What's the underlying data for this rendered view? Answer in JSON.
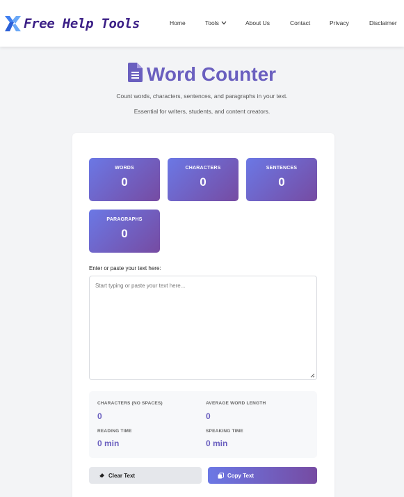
{
  "header": {
    "logo_text": "Free Help Tools",
    "nav": [
      {
        "label": "Home"
      },
      {
        "label": "Tools",
        "has_dropdown": true
      },
      {
        "label": "About Us"
      },
      {
        "label": "Contact"
      },
      {
        "label": "Privacy"
      },
      {
        "label": "Disclaimer"
      }
    ]
  },
  "hero": {
    "title": "Word Counter",
    "icon": "document-icon",
    "subtitle_1": "Count words, characters, sentences, and paragraphs in your text.",
    "subtitle_2": "Essential for writers, students, and content creators."
  },
  "stats": [
    {
      "label": "WORDS",
      "value": "0"
    },
    {
      "label": "CHARACTERS",
      "value": "0"
    },
    {
      "label": "SENTENCES",
      "value": "0"
    },
    {
      "label": "PARAGRAPHS",
      "value": "0"
    }
  ],
  "editor": {
    "label": "Enter or paste your text here:",
    "placeholder": "Start typing or paste your text here...",
    "value": ""
  },
  "details": {
    "chars_no_spaces_label": "CHARACTERS (NO SPACES)",
    "chars_no_spaces_value": "0",
    "avg_word_length_label": "AVERAGE WORD LENGTH",
    "avg_word_length_value": "0",
    "reading_time_label": "READING TIME",
    "reading_time_value": "0 min",
    "speaking_time_label": "SPEAKING TIME",
    "speaking_time_value": "0 min"
  },
  "buttons": {
    "clear_label": "Clear Text",
    "clear_icon": "eraser-icon",
    "copy_label": "Copy Text",
    "copy_icon": "copy-icon"
  },
  "colors": {
    "accent": "#6a5fbf",
    "gradient_start": "#6b78e5",
    "gradient_end": "#764ba2",
    "logo_blue": "#3f7ff0",
    "logo_text": "#3b1f86"
  }
}
